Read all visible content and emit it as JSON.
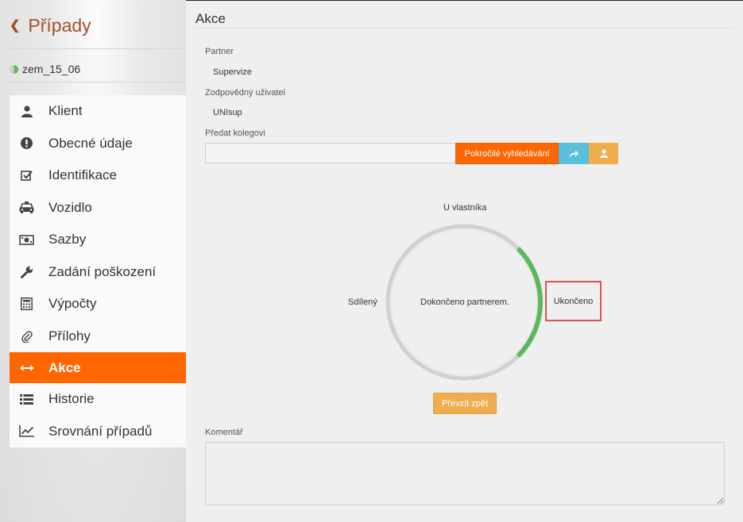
{
  "sidebar": {
    "back_label": "Případy",
    "case_id": "zem_15_06",
    "items": [
      {
        "label": "Klient",
        "icon": "user-icon"
      },
      {
        "label": "Obecné údaje",
        "icon": "exclamation-circle-icon"
      },
      {
        "label": "Identifikace",
        "icon": "check-square-icon"
      },
      {
        "label": "Vozidlo",
        "icon": "taxi-icon"
      },
      {
        "label": "Sazby",
        "icon": "money-bill-icon"
      },
      {
        "label": "Zadání poškození",
        "icon": "wrench-icon"
      },
      {
        "label": "Výpočty",
        "icon": "calculator-icon"
      },
      {
        "label": "Přílohy",
        "icon": "paperclip-icon"
      },
      {
        "label": "Akce",
        "icon": "arrows-horizontal-icon",
        "active": true
      },
      {
        "label": "Historie",
        "icon": "list-icon"
      },
      {
        "label": "Srovnání případů",
        "icon": "line-chart-icon"
      }
    ]
  },
  "main": {
    "title": "Akce",
    "partner_label": "Partner",
    "partner_value": "Supervize",
    "responsible_label": "Zodpovědný uživatel",
    "responsible_value": "UNIsup",
    "handover_label": "Předat kolegovi",
    "handover_input_value": "",
    "advanced_search_label": "Pokročilé vyhledávání",
    "workflow": {
      "state_top": "U vlastníka",
      "state_left": "Sdílený",
      "state_right": "Ukončeno",
      "current_state": "Dokončeno partnerem.",
      "progress_fraction": 0.25
    },
    "return_button_label": "Převzít zpět",
    "comment_label": "Komentář",
    "comment_value": ""
  },
  "colors": {
    "accent": "#ff6600",
    "back_link": "#a0522d",
    "info_button": "#5bc0de",
    "warning_button": "#f0ad4e",
    "ring_progress": "#5cb85c",
    "ring_track": "#d0d0d0",
    "highlight_border": "#d9534f"
  }
}
